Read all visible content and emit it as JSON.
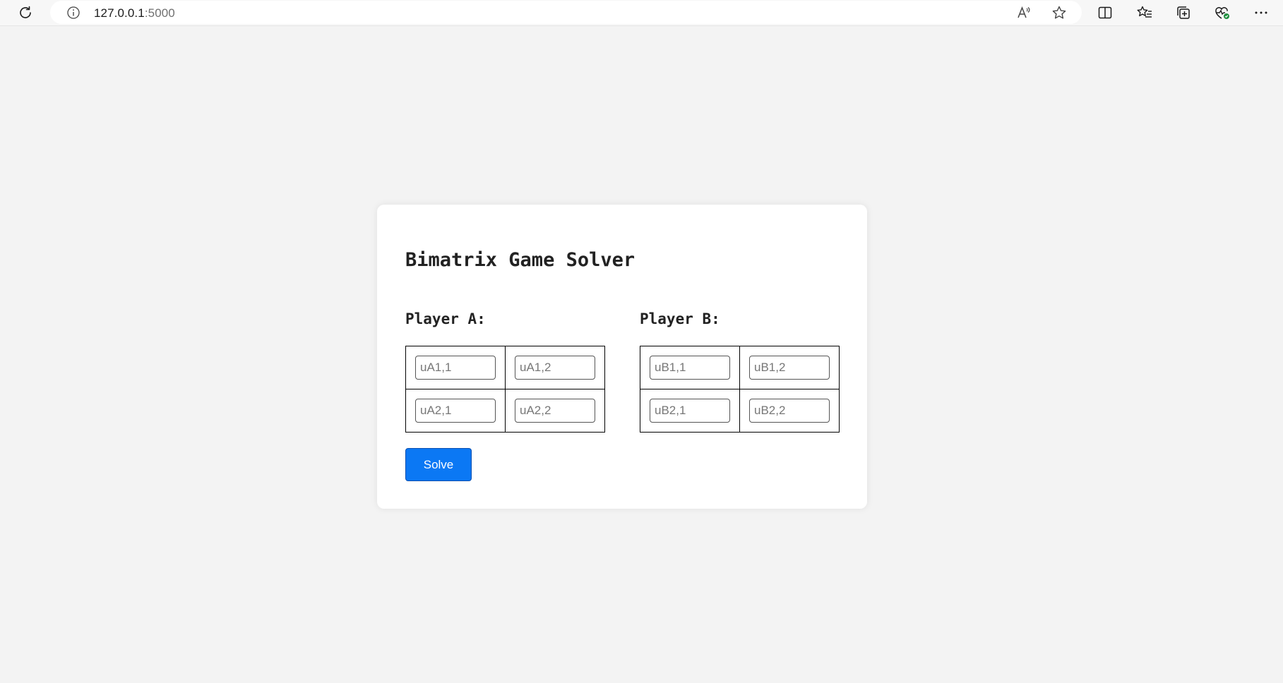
{
  "browser": {
    "url_host": "127.0.0.1",
    "url_port": ":5000",
    "icons": [
      "refresh-icon",
      "site-info-icon",
      "read-aloud-icon",
      "favorite-star-icon",
      "split-screen-icon",
      "favorites-icon",
      "collections-icon",
      "browser-health-icon",
      "more-menu-icon"
    ]
  },
  "page": {
    "title": "Bimatrix Game Solver",
    "player_a": {
      "label": "Player A:",
      "cells": {
        "r1c1": "uA1,1",
        "r1c2": "uA1,2",
        "r2c1": "uA2,1",
        "r2c2": "uA2,2"
      }
    },
    "player_b": {
      "label": "Player B:",
      "cells": {
        "r1c1": "uB1,1",
        "r1c2": "uB1,2",
        "r2c1": "uB2,1",
        "r2c2": "uB2,2"
      }
    },
    "solve_label": "Solve"
  },
  "colors": {
    "background": "#f3f3f3",
    "card": "#ffffff",
    "button": "#0b78f4"
  }
}
